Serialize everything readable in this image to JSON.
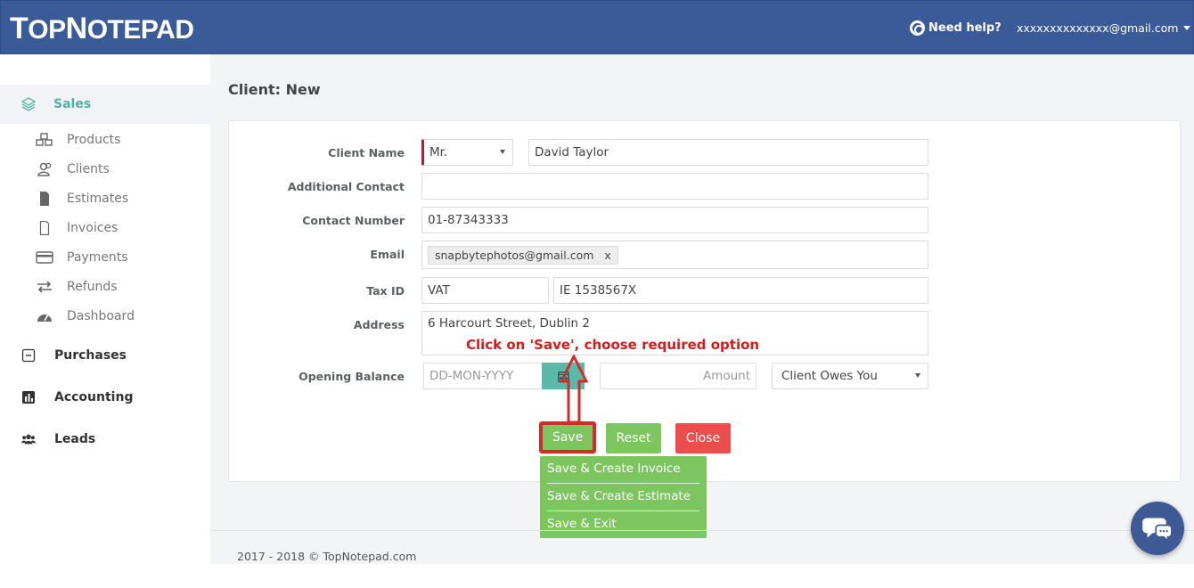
{
  "header": {
    "logo_prefix": "T",
    "logo_rest_1": "OP",
    "logo_n": "N",
    "logo_rest_2": "OTEPAD",
    "help_label": "Need help?",
    "account_email": "xxxxxxxxxxxxxx@gmail.com"
  },
  "sidebar": {
    "sales": "Sales",
    "items": [
      "Products",
      "Clients",
      "Estimates",
      "Invoices",
      "Payments",
      "Refunds",
      "Dashboard"
    ],
    "purchases": "Purchases",
    "accounting": "Accounting",
    "leads": "Leads"
  },
  "page": {
    "title": "Client: New"
  },
  "form": {
    "client_name_label": "Client Name",
    "salutation": "Mr.",
    "client_name": "David Taylor",
    "additional_contact_label": "Additional Contact",
    "additional_contact": "",
    "contact_number_label": "Contact Number",
    "contact_number": "01-87343333",
    "email_label": "Email",
    "email_chip": "snapbytephotos@gmail.com",
    "email_chip_remove": "x",
    "tax_id_label": "Tax ID",
    "tax_type": "VAT",
    "tax_number": "IE 1538567X",
    "address_label": "Address",
    "address": "6 Harcourt Street, Dublin 2",
    "opening_balance_label": "Opening Balance",
    "date_placeholder": "DD-MON-YYYY",
    "amount_placeholder": "Amount",
    "balance_type": "Client Owes You"
  },
  "buttons": {
    "save": "Save",
    "reset": "Reset",
    "close": "Close"
  },
  "save_menu": [
    "Save & Create Invoice",
    "Save & Create Estimate",
    "Save & Exit"
  ],
  "annotation": "Click on 'Save', choose required option",
  "footer": "2017 - 2018 © TopNotepad.com",
  "colors": {
    "header": "#3a5a98",
    "accent": "#5cb8a8",
    "green": "#7dc65f",
    "red": "#ee4d4d",
    "annotation": "#d51c1c"
  }
}
